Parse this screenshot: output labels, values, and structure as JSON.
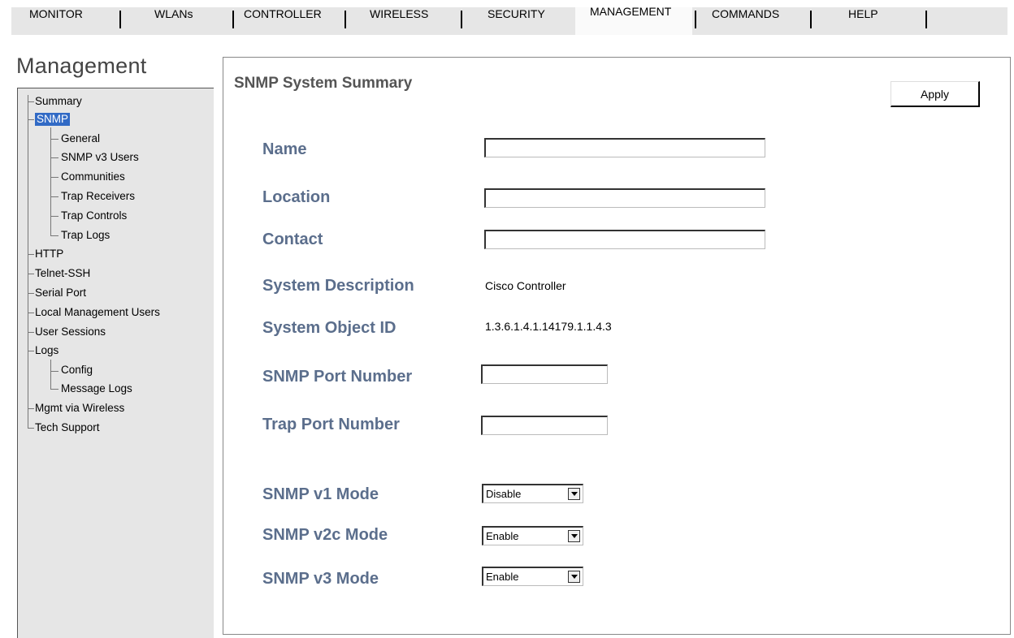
{
  "nav": {
    "tabs": [
      "MONITOR",
      "WLANs",
      "CONTROLLER",
      "WIRELESS",
      "SECURITY",
      "MANAGEMENT",
      "COMMANDS",
      "HELP"
    ],
    "active": "MANAGEMENT"
  },
  "sidebar": {
    "title": "Management",
    "items": {
      "summary": "Summary",
      "snmp": "SNMP",
      "general": "General",
      "snmp_v3_users": "SNMP v3 Users",
      "communities": "Communities",
      "trap_receivers": "Trap Receivers",
      "trap_controls": "Trap Controls",
      "trap_logs": "Trap Logs",
      "http": "HTTP",
      "telnet_ssh": "Telnet-SSH",
      "serial_port": "Serial Port",
      "local_mgmt_users": "Local Management Users",
      "user_sessions": "User Sessions",
      "logs": "Logs",
      "config": "Config",
      "message_logs": "Message Logs",
      "mgmt_via_wireless": "Mgmt via Wireless",
      "tech_support": "Tech Support"
    },
    "selected": "SNMP"
  },
  "main": {
    "title": "SNMP System Summary",
    "apply_label": "Apply",
    "fields": {
      "name_label": "Name",
      "name_value": "",
      "location_label": "Location",
      "location_value": "",
      "contact_label": "Contact",
      "contact_value": "",
      "sysdesc_label": "System Description",
      "sysdesc_value": "Cisco Controller",
      "sysoid_label": "System Object ID",
      "sysoid_value": "1.3.6.1.4.1.14179.1.1.4.3",
      "snmp_port_label": "SNMP Port Number",
      "snmp_port_value": "",
      "trap_port_label": "Trap Port Number",
      "trap_port_value": "",
      "v1_label": "SNMP v1 Mode",
      "v1_value": "Disable",
      "v2c_label": "SNMP v2c Mode",
      "v2c_value": "Enable",
      "v3_label": "SNMP v3 Mode",
      "v3_value": "Enable"
    }
  },
  "colors": {
    "label": "#5b6e8c",
    "selected_bg": "#316ac5",
    "nav_bg": "#e6e6e6"
  }
}
